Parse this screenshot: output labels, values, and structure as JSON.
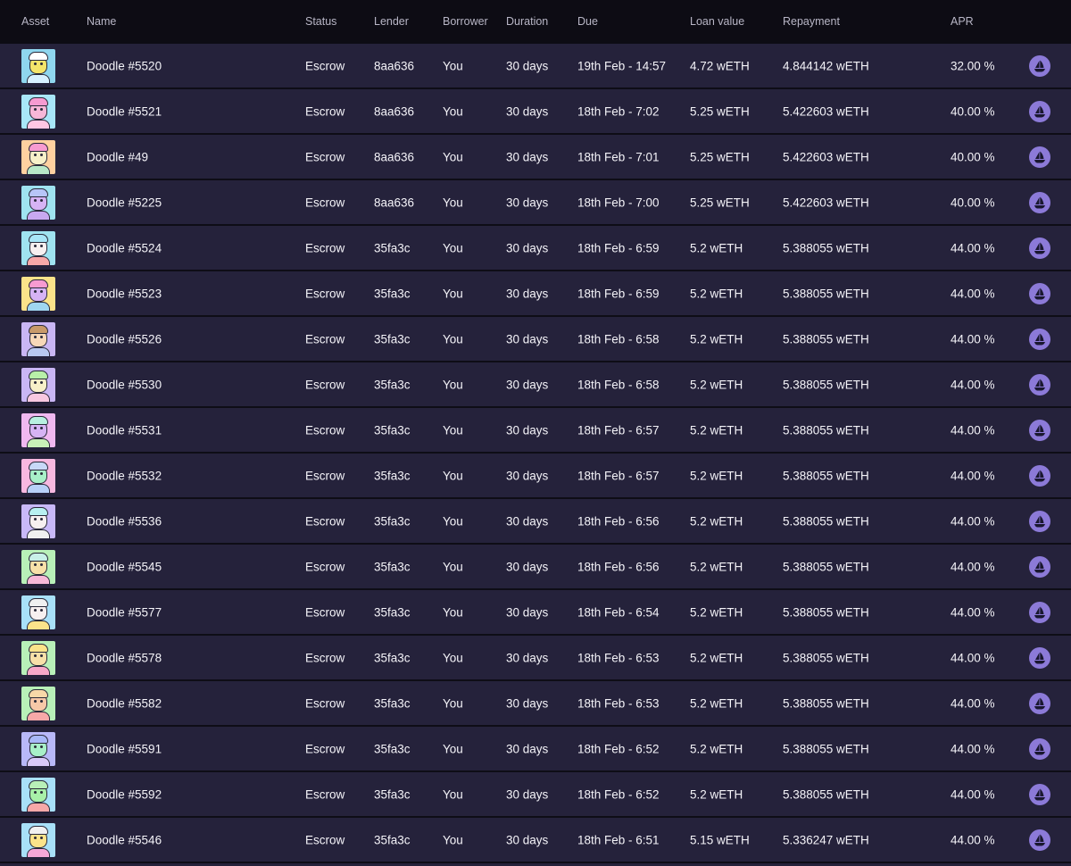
{
  "columns": {
    "asset": "Asset",
    "name": "Name",
    "status": "Status",
    "lender": "Lender",
    "borrower": "Borrower",
    "duration": "Duration",
    "due": "Due",
    "loan_value": "Loan value",
    "repayment": "Repayment",
    "apr": "APR"
  },
  "action_icon": "opensea-ship-icon",
  "colors": {
    "header_bg": "#0d0c14",
    "row_bg": "#25223b",
    "divider": "#0e0d16",
    "action_button": "#8c7ad8"
  },
  "rows": [
    {
      "name": "Doodle #5520",
      "status": "Escrow",
      "lender": "8aa636",
      "borrower": "You",
      "duration": "30 days",
      "due": "19th Feb - 14:57",
      "loan_value": "4.72 wETH",
      "repayment": "4.844142 wETH",
      "apr": "32.00 %",
      "thumb": {
        "bg": "#8fd6ee",
        "skin": "#f4e46a",
        "hair": "#ffffff",
        "shirt": "#d7f0ff"
      }
    },
    {
      "name": "Doodle #5521",
      "status": "Escrow",
      "lender": "8aa636",
      "borrower": "You",
      "duration": "30 days",
      "due": "18th Feb - 7:02",
      "loan_value": "5.25 wETH",
      "repayment": "5.422603 wETH",
      "apr": "40.00 %",
      "thumb": {
        "bg": "#a8e6f8",
        "skin": "#f7b7d8",
        "hair": "#f79bd1",
        "shirt": "#ffc7e3"
      }
    },
    {
      "name": "Doodle #49",
      "status": "Escrow",
      "lender": "8aa636",
      "borrower": "You",
      "duration": "30 days",
      "due": "18th Feb - 7:01",
      "loan_value": "5.25 wETH",
      "repayment": "5.422603 wETH",
      "apr": "40.00 %",
      "thumb": {
        "bg": "#ffd1a0",
        "skin": "#f7f0c8",
        "hair": "#f79bd1",
        "shirt": "#b8e8c8"
      }
    },
    {
      "name": "Doodle #5225",
      "status": "Escrow",
      "lender": "8aa636",
      "borrower": "You",
      "duration": "30 days",
      "due": "18th Feb - 7:00",
      "loan_value": "5.25 wETH",
      "repayment": "5.422603 wETH",
      "apr": "40.00 %",
      "thumb": {
        "bg": "#9fe3f0",
        "skin": "#d6b3f4",
        "hair": "#b7c5f8",
        "shirt": "#c8a8f0"
      }
    },
    {
      "name": "Doodle #5524",
      "status": "Escrow",
      "lender": "35fa3c",
      "borrower": "You",
      "duration": "30 days",
      "due": "18th Feb - 6:59",
      "loan_value": "5.2 wETH",
      "repayment": "5.388055 wETH",
      "apr": "44.00 %",
      "thumb": {
        "bg": "#9fe3f0",
        "skin": "#f7f0f0",
        "hair": "#a8e6f8",
        "shirt": "#f7a8a8"
      }
    },
    {
      "name": "Doodle #5523",
      "status": "Escrow",
      "lender": "35fa3c",
      "borrower": "You",
      "duration": "30 days",
      "due": "18th Feb - 6:59",
      "loan_value": "5.2 wETH",
      "repayment": "5.388055 wETH",
      "apr": "44.00 %",
      "thumb": {
        "bg": "#fbe38a",
        "skin": "#d6b3f4",
        "hair": "#f79bd1",
        "shirt": "#9fd6f0"
      }
    },
    {
      "name": "Doodle #5526",
      "status": "Escrow",
      "lender": "35fa3c",
      "borrower": "You",
      "duration": "30 days",
      "due": "18th Feb - 6:58",
      "loan_value": "5.2 wETH",
      "repayment": "5.388055 wETH",
      "apr": "44.00 %",
      "thumb": {
        "bg": "#c9b6f4",
        "skin": "#f7d8b8",
        "hair": "#c89a6a",
        "shirt": "#b8c8f0"
      }
    },
    {
      "name": "Doodle #5530",
      "status": "Escrow",
      "lender": "35fa3c",
      "borrower": "You",
      "duration": "30 days",
      "due": "18th Feb - 6:58",
      "loan_value": "5.2 wETH",
      "repayment": "5.388055 wETH",
      "apr": "44.00 %",
      "thumb": {
        "bg": "#c9b6f4",
        "skin": "#f7f0c8",
        "hair": "#b8f0a8",
        "shirt": "#f7c8e0"
      }
    },
    {
      "name": "Doodle #5531",
      "status": "Escrow",
      "lender": "35fa3c",
      "borrower": "You",
      "duration": "30 days",
      "due": "18th Feb - 6:57",
      "loan_value": "5.2 wETH",
      "repayment": "5.388055 wETH",
      "apr": "44.00 %",
      "thumb": {
        "bg": "#f0b8f0",
        "skin": "#d6b3f4",
        "hair": "#b8f0e0",
        "shirt": "#c8f0b8"
      }
    },
    {
      "name": "Doodle #5532",
      "status": "Escrow",
      "lender": "35fa3c",
      "borrower": "You",
      "duration": "30 days",
      "due": "18th Feb - 6:57",
      "loan_value": "5.2 wETH",
      "repayment": "5.388055 wETH",
      "apr": "44.00 %",
      "thumb": {
        "bg": "#f7b8e0",
        "skin": "#a8f0c8",
        "hair": "#c8d8f8",
        "shirt": "#b8d0f8"
      }
    },
    {
      "name": "Doodle #5536",
      "status": "Escrow",
      "lender": "35fa3c",
      "borrower": "You",
      "duration": "30 days",
      "due": "18th Feb - 6:56",
      "loan_value": "5.2 wETH",
      "repayment": "5.388055 wETH",
      "apr": "44.00 %",
      "thumb": {
        "bg": "#c8b8f8",
        "skin": "#f7f0f0",
        "hair": "#b8f0f0",
        "shirt": "#f0f0f0"
      }
    },
    {
      "name": "Doodle #5545",
      "status": "Escrow",
      "lender": "35fa3c",
      "borrower": "You",
      "duration": "30 days",
      "due": "18th Feb - 6:56",
      "loan_value": "5.2 wETH",
      "repayment": "5.388055 wETH",
      "apr": "44.00 %",
      "thumb": {
        "bg": "#b8f0b8",
        "skin": "#f7e0a8",
        "hair": "#c8f0e8",
        "shirt": "#f7b8d8"
      }
    },
    {
      "name": "Doodle #5577",
      "status": "Escrow",
      "lender": "35fa3c",
      "borrower": "You",
      "duration": "30 days",
      "due": "18th Feb - 6:54",
      "loan_value": "5.2 wETH",
      "repayment": "5.388055 wETH",
      "apr": "44.00 %",
      "thumb": {
        "bg": "#a8e0f8",
        "skin": "#f7f0f0",
        "hair": "#f0f0f0",
        "shirt": "#fbe38a"
      }
    },
    {
      "name": "Doodle #5578",
      "status": "Escrow",
      "lender": "35fa3c",
      "borrower": "You",
      "duration": "30 days",
      "due": "18th Feb - 6:53",
      "loan_value": "5.2 wETH",
      "repayment": "5.388055 wETH",
      "apr": "44.00 %",
      "thumb": {
        "bg": "#b8f0b8",
        "skin": "#f7e0a8",
        "hair": "#fbe38a",
        "shirt": "#f7a8c8"
      }
    },
    {
      "name": "Doodle #5582",
      "status": "Escrow",
      "lender": "35fa3c",
      "borrower": "You",
      "duration": "30 days",
      "due": "18th Feb - 6:53",
      "loan_value": "5.2 wETH",
      "repayment": "5.388055 wETH",
      "apr": "44.00 %",
      "thumb": {
        "bg": "#b8f0b8",
        "skin": "#f7c8a8",
        "hair": "#f7d8a8",
        "shirt": "#f7a8a8"
      }
    },
    {
      "name": "Doodle #5591",
      "status": "Escrow",
      "lender": "35fa3c",
      "borrower": "You",
      "duration": "30 days",
      "due": "18th Feb - 6:52",
      "loan_value": "5.2 wETH",
      "repayment": "5.388055 wETH",
      "apr": "44.00 %",
      "thumb": {
        "bg": "#b8b8f8",
        "skin": "#a8f0c8",
        "hair": "#a8b8f8",
        "shirt": "#d8c8f8"
      }
    },
    {
      "name": "Doodle #5592",
      "status": "Escrow",
      "lender": "35fa3c",
      "borrower": "You",
      "duration": "30 days",
      "due": "18th Feb - 6:52",
      "loan_value": "5.2 wETH",
      "repayment": "5.388055 wETH",
      "apr": "44.00 %",
      "thumb": {
        "bg": "#a8e0f8",
        "skin": "#a8f0a8",
        "hair": "#b8f0b8",
        "shirt": "#f7a8a8"
      }
    },
    {
      "name": "Doodle #5546",
      "status": "Escrow",
      "lender": "35fa3c",
      "borrower": "You",
      "duration": "30 days",
      "due": "18th Feb - 6:51",
      "loan_value": "5.15 wETH",
      "repayment": "5.336247 wETH",
      "apr": "44.00 %",
      "thumb": {
        "bg": "#a8e0f8",
        "skin": "#fbe38a",
        "hair": "#f0f0f0",
        "shirt": "#f7a8d8"
      }
    }
  ]
}
